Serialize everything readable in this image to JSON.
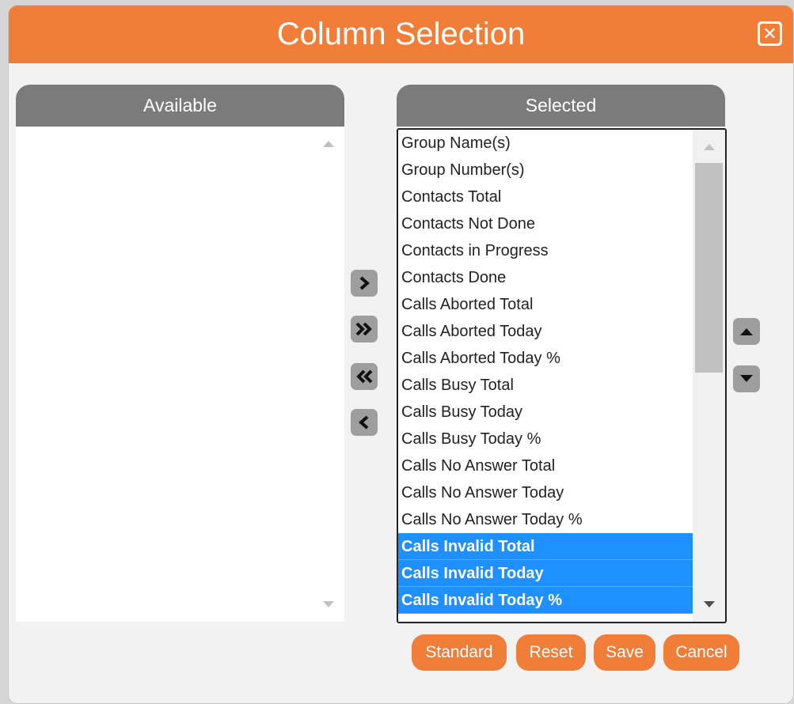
{
  "dialog": {
    "title": "Column Selection",
    "close_icon": "close-icon"
  },
  "available": {
    "header": "Available",
    "items": []
  },
  "selected": {
    "header": "Selected",
    "items": [
      {
        "label": "Group Name(s)",
        "highlighted": false
      },
      {
        "label": "Group Number(s)",
        "highlighted": false
      },
      {
        "label": "Contacts Total",
        "highlighted": false
      },
      {
        "label": "Contacts Not Done",
        "highlighted": false
      },
      {
        "label": "Contacts in Progress",
        "highlighted": false
      },
      {
        "label": "Contacts Done",
        "highlighted": false
      },
      {
        "label": "Calls Aborted Total",
        "highlighted": false
      },
      {
        "label": "Calls Aborted Today",
        "highlighted": false
      },
      {
        "label": "Calls Aborted Today %",
        "highlighted": false
      },
      {
        "label": "Calls Busy Total",
        "highlighted": false
      },
      {
        "label": "Calls Busy Today",
        "highlighted": false
      },
      {
        "label": "Calls Busy Today %",
        "highlighted": false
      },
      {
        "label": "Calls No Answer Total",
        "highlighted": false
      },
      {
        "label": "Calls No Answer Today",
        "highlighted": false
      },
      {
        "label": "Calls No Answer Today %",
        "highlighted": false
      },
      {
        "label": "Calls Invalid Total",
        "highlighted": true
      },
      {
        "label": "Calls Invalid Today",
        "highlighted": true
      },
      {
        "label": "Calls Invalid Today %",
        "highlighted": true
      }
    ]
  },
  "transfer_buttons": [
    {
      "icon": "chevron-right-icon"
    },
    {
      "icon": "double-chevron-right-icon"
    },
    {
      "icon": "double-chevron-left-icon"
    },
    {
      "icon": "chevron-left-icon"
    }
  ],
  "order_buttons": [
    {
      "icon": "move-up-icon"
    },
    {
      "icon": "move-down-icon"
    }
  ],
  "footer": {
    "standard_label": "Standard",
    "reset_label": "Reset",
    "save_label": "Save",
    "cancel_label": "Cancel"
  },
  "colors": {
    "accent": "#f07d38",
    "panel_header": "#7b7b7b",
    "selection": "#1e90ff",
    "button_gray": "#9e9e9e"
  }
}
